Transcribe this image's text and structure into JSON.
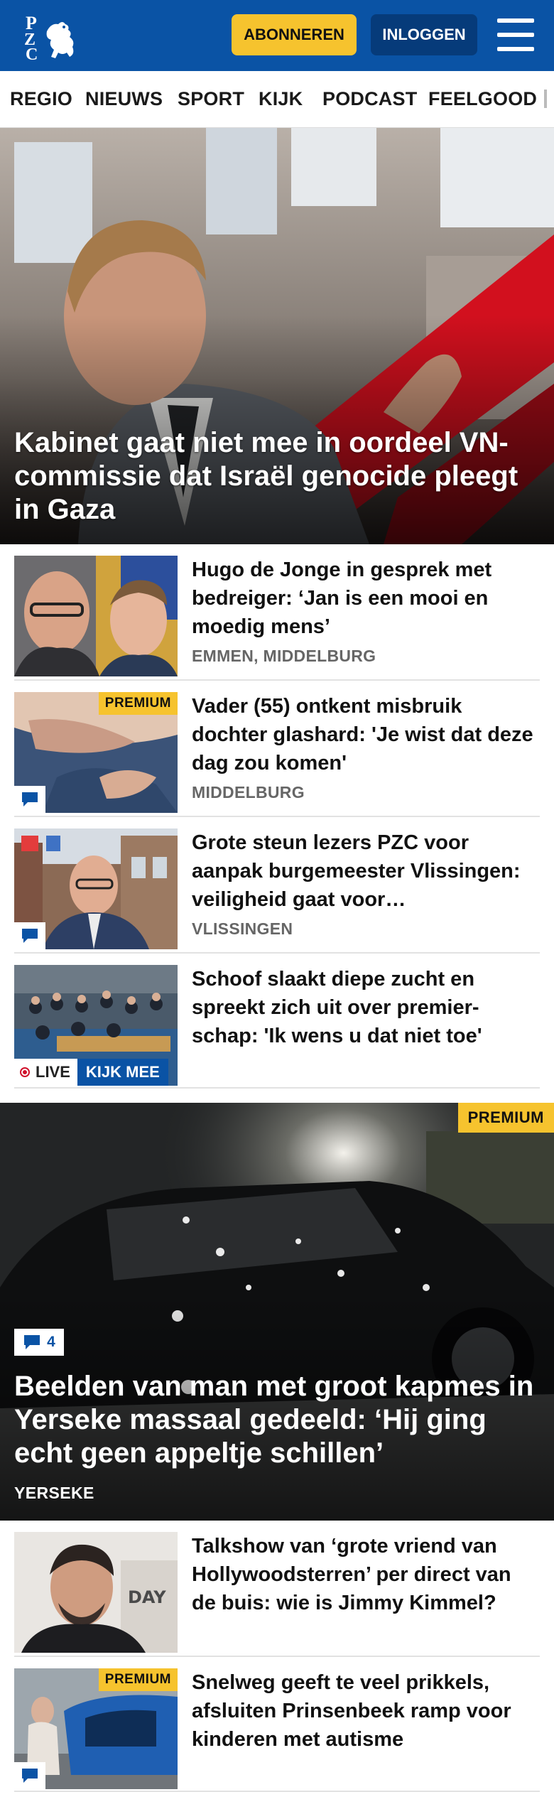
{
  "header": {
    "logo_letters": [
      "P",
      "Z",
      "C"
    ],
    "subscribe_label": "ABONNEREN",
    "login_label": "INLOGGEN",
    "menu_icon": "hamburger-icon",
    "brand_color": "#0a53a5",
    "accent_color": "#f6c32e"
  },
  "nav": {
    "items": [
      "REGIO",
      "NIEUWS",
      "SPORT",
      "KIJK",
      "PODCAST",
      "FEELGOOD"
    ]
  },
  "hero": {
    "title": "Kabinet gaat niet mee in oordeel VN-commissie dat Israël genocide pleegt in Gaza"
  },
  "articles": [
    {
      "title": "Hugo de Jonge in gesprek met bedreiger: ‘Jan is een mooi en moedig mens’",
      "location": "EMMEN, MIDDELBURG"
    },
    {
      "title": "Vader (55) ontkent misbruik dochter glashard: 'Je wist dat deze dag zou komen'",
      "location": "MIDDELBURG",
      "badge": "PREMIUM",
      "comment_icon": "comment-icon"
    },
    {
      "title": "Grote steun lezers PZC voor aanpak burgemeester Vlissingen: veiligheid gaat voor…",
      "location": "VLISSINGEN",
      "comment_icon": "comment-icon"
    },
    {
      "title": "Schoof slaakt diepe zucht en spreekt zich uit over premier-schap: 'Ik wens u dat niet toe'",
      "live_label": "LIVE",
      "watch_label": "KIJK MEE"
    }
  ],
  "feature": {
    "badge": "PREMIUM",
    "comment_count": "4",
    "title": "Beelden van man met groot kapmes in Yerseke massaal gedeeld: ‘Hij ging echt geen appeltje schillen’",
    "location": "YERSEKE"
  },
  "articles_bottom": [
    {
      "title": "Talkshow van ‘grote vriend van Hollywoodsterren’ per direct van de buis: wie is Jimmy Kimmel?"
    },
    {
      "title": "Snelweg geeft te veel prikkels, afsluiten Prinsenbeek ramp voor kinderen met autisme",
      "badge": "PREMIUM",
      "comment_icon": "comment-icon"
    }
  ]
}
